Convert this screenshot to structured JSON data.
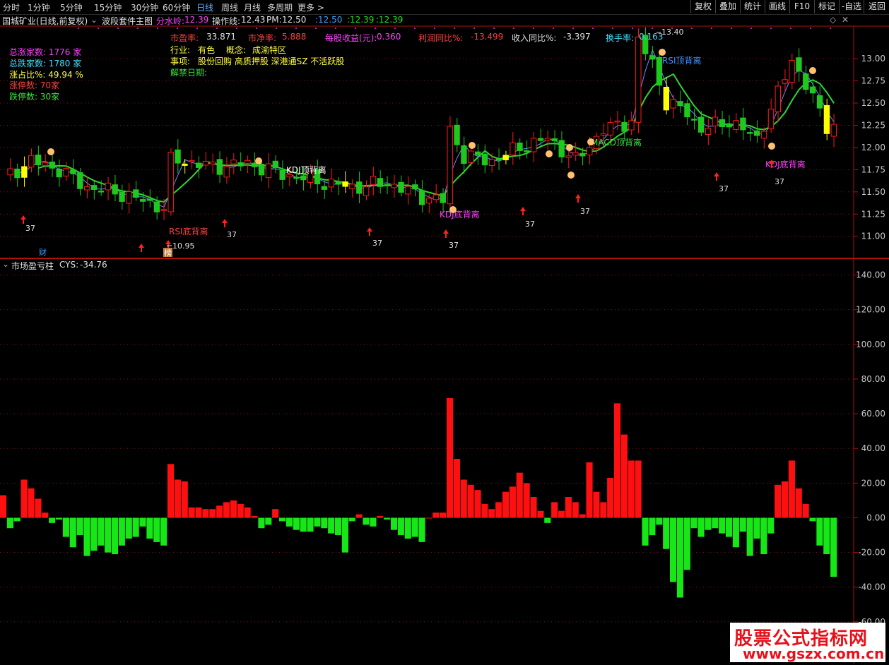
{
  "toolbar": {
    "tabs": [
      "分时",
      "1分钟",
      "5分钟",
      "15分钟",
      "30分钟",
      "60分钟",
      "日线",
      "周线",
      "月线",
      "多周期",
      "更多 >"
    ],
    "active_index": 6,
    "right_buttons": [
      "复权",
      "叠加",
      "统计",
      "画线",
      "F10",
      "标记",
      "-自选",
      "返回"
    ]
  },
  "info": {
    "stock": "国城矿业(日线,前复权)",
    "indicator": "波段套件主图",
    "fsl_label": "分水岭:",
    "fsl_value": "12.39",
    "czx_label": "操作线:",
    "czx_value": "12.43",
    "pm_label": "PM:",
    "pm_value": "12.50",
    "v1": ":12.50",
    "v2": ":12.39",
    "v3": ":12.39"
  },
  "fund": {
    "pe_label": "市盈率:",
    "pe": "33.871",
    "pb_label": "市净率:",
    "pb": "5.888",
    "eps_label": "每股收益(元):",
    "eps": "0.360",
    "profit_label": "利润同比%:",
    "profit": "-13.499",
    "rev_label": "收入同比%:",
    "rev": "-3.397",
    "turn_label": "换手率:",
    "turn": "0.163",
    "industry_label": "行业:",
    "industry": "有色",
    "concept_label": "概念:",
    "concept": "成渝特区",
    "event_label": "事项:",
    "event": "股份回购 高质押股 深港通SZ 不活跃股",
    "unlock_label": "解禁日期:"
  },
  "breadth": {
    "up": "总涨家数:  1776 家",
    "down": "总跌家数:  1780 家",
    "ratio": "涨占比%:  49.94 %",
    "limit_up": "涨停数:  70家",
    "limit_down": "跌停数:  30家"
  },
  "main_chart": {
    "y_ticks": [
      "13.00",
      "12.75",
      "12.50",
      "12.25",
      "12.00",
      "11.75",
      "11.50",
      "11.25",
      "11.00"
    ],
    "high_label": "13.40",
    "low_label": "10.95",
    "signals": [
      "KDJ顶背离",
      "RSI底背离",
      "KDJ底背离",
      "RSI顶背离",
      "MACD顶背离",
      "KDJ底背离"
    ],
    "arrow_value": "37",
    "cai_mark": "财",
    "bang_mark": "榜"
  },
  "sub_chart": {
    "title": "市场盈亏柱",
    "cys_label": "CYS:",
    "cys_value": "-34.76",
    "y_ticks": [
      "140.00",
      "120.00",
      "100.00",
      "80.00",
      "60.00",
      "40.00",
      "20.00",
      "0.00",
      "-20.00",
      "-40.00",
      "-60.00"
    ]
  },
  "chart_data": {
    "type": "bar",
    "title": "市场盈亏柱",
    "ylim": [
      -80,
      150
    ],
    "values": [
      13,
      -6,
      -2,
      22,
      17,
      11,
      3,
      -3,
      -1,
      -11,
      -17,
      -10,
      -22,
      -19,
      -16,
      -20,
      -21,
      -16,
      -12,
      -11,
      -5,
      -12,
      -14,
      -16,
      31,
      22,
      21,
      6,
      6,
      5,
      5,
      7,
      9,
      10,
      8,
      6,
      1,
      -6,
      -4,
      5,
      -2,
      -5,
      -7,
      -8,
      -8,
      -5,
      -6,
      -9,
      -10,
      -20,
      -2,
      2,
      -4,
      -5,
      1,
      -1,
      -7,
      -10,
      -12,
      -11,
      -14,
      0,
      3,
      3,
      69,
      34,
      22,
      19,
      16,
      8,
      5,
      9,
      15,
      18,
      26,
      20,
      12,
      4,
      -3,
      9,
      4,
      12,
      9,
      2,
      32,
      15,
      9,
      23,
      66,
      48,
      33,
      33,
      -16,
      -10,
      -4,
      -18,
      -37,
      -46,
      -30,
      -6,
      -11,
      -7,
      -6,
      -9,
      -11,
      -17,
      -8,
      -22,
      -12,
      -21,
      -9,
      19,
      21,
      33,
      17,
      8,
      -2,
      -16,
      -21,
      -34
    ],
    "colors": {
      "up": "#ff1010",
      "down": "#17e617"
    }
  },
  "watermark": {
    "title": "股票公式指标网",
    "url": "www.gszx.com.cn"
  }
}
